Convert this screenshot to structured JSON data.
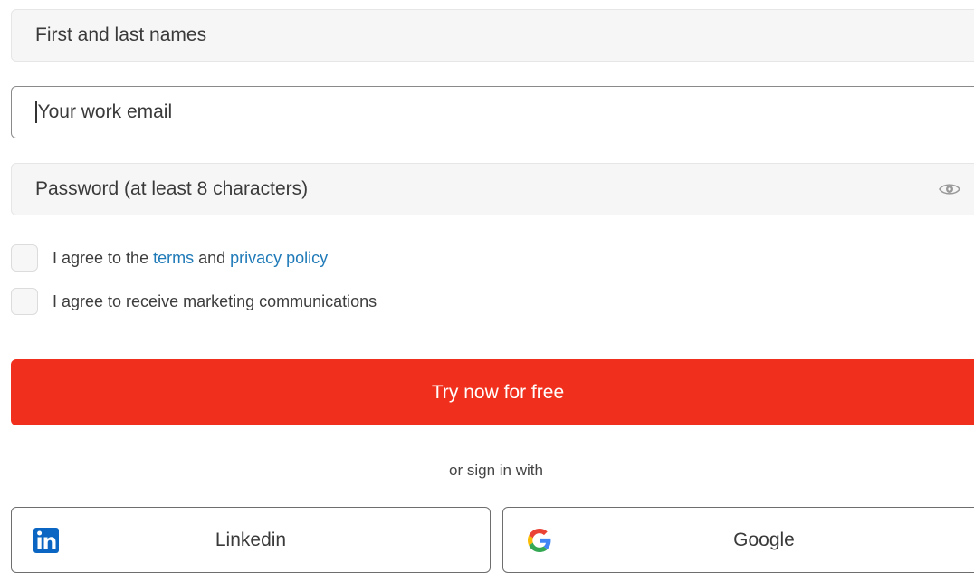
{
  "form": {
    "name_placeholder": "First and last names",
    "email_placeholder": "Your work email",
    "password_placeholder": "Password (at least 8 characters)",
    "terms": {
      "prefix": "I agree to the ",
      "terms_link": "terms",
      "middle": " and ",
      "privacy_link": "privacy policy"
    },
    "marketing_label": "I agree to receive marketing communications",
    "submit_label": "Try now for free"
  },
  "social": {
    "divider_text": "or sign in with",
    "linkedin_label": "Linkedin",
    "google_label": "Google"
  },
  "colors": {
    "cta": "#f0301d",
    "link": "#1f7ab8",
    "linkedin": "#0a66c2"
  },
  "icons": {
    "password_toggle": "eye-icon",
    "linkedin": "linkedin-icon",
    "google": "google-icon"
  }
}
